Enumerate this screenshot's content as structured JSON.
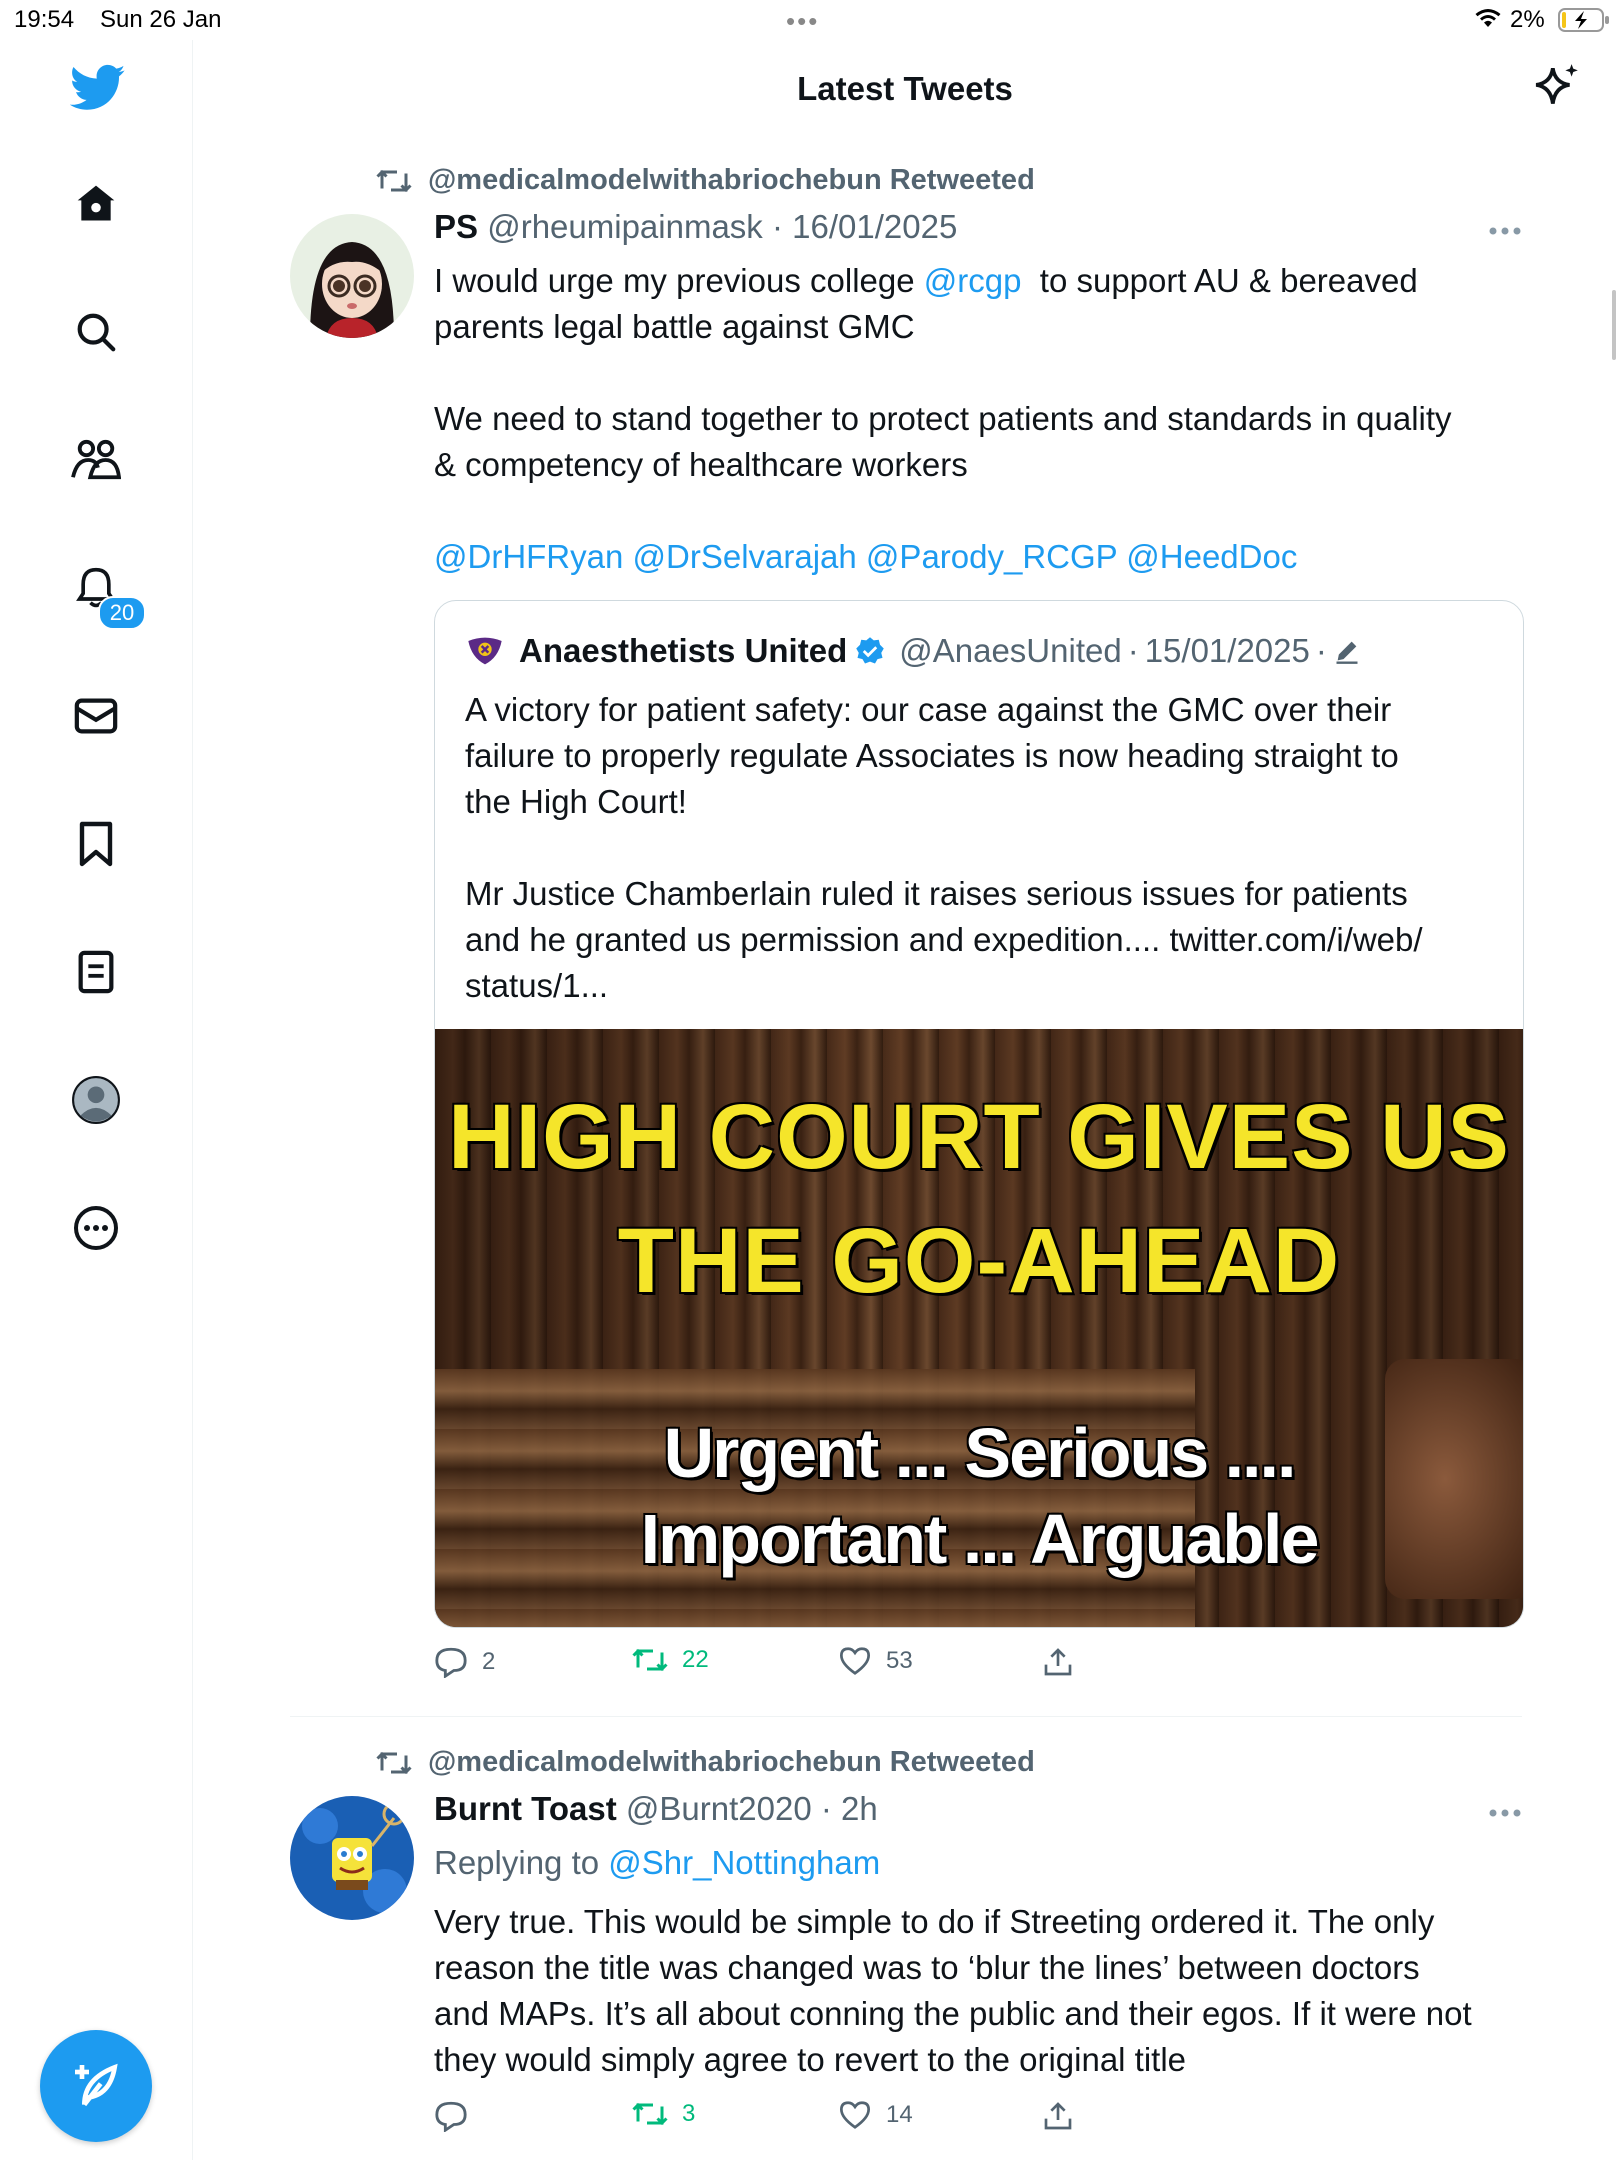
{
  "status_bar": {
    "time": "19:54",
    "date": "Sun 26 Jan",
    "dots": "•••",
    "battery": "2%"
  },
  "header": {
    "title": "Latest Tweets"
  },
  "sidebar": {
    "items": [
      {
        "icon": "home-icon"
      },
      {
        "icon": "search-icon"
      },
      {
        "icon": "communities-icon"
      },
      {
        "icon": "notifications-icon",
        "badge": "20"
      },
      {
        "icon": "messages-icon"
      },
      {
        "icon": "bookmark-icon"
      },
      {
        "icon": "lists-icon"
      },
      {
        "icon": "profile-icon"
      },
      {
        "icon": "more-icon"
      }
    ]
  },
  "tweets": [
    {
      "retweeted_by": "@medicalmodelwithabriochebun Retweeted",
      "name": "PS",
      "handle": "@rheumipainmask",
      "sep": "·",
      "date": "16/01/2025",
      "text_line1_pre": "I would urge my previous college ",
      "mention_rcgp": "@rcgp",
      "text_line1_post": "  to support AU & bereaved",
      "text_line2": "parents legal battle against GMC",
      "text_line3": "We need to stand together to protect patients and standards in quality",
      "text_line4": "& competency of healthcare workers",
      "mentions": "@DrHFRyan @DrSelvarajah @Parody_RCGP @HeedDoc",
      "quote": {
        "name": "Anaesthetists United",
        "handle": "@AnaesUnited",
        "date": "15/01/2025",
        "sep": "·",
        "lines": [
          "A victory for patient safety: our case against the GMC over their",
          "failure to properly regulate Associates is now heading straight to",
          "the High Court!",
          "",
          "Mr Justice Chamberlain ruled it raises serious issues for patients",
          "and he granted us permission and expedition.... twitter.com/i/web/",
          "status/1..."
        ],
        "image_headline_1": "HIGH COURT GIVES US",
        "image_headline_2": "THE GO-AHEAD",
        "image_sub_1": "Urgent ... Serious ....",
        "image_sub_2": "Important ... Arguable"
      },
      "replies": "2",
      "retweets": "22",
      "likes": "53"
    },
    {
      "retweeted_by": "@medicalmodelwithabriochebun Retweeted",
      "name": "Burnt Toast",
      "handle": "@Burnt2020",
      "sep": "·",
      "date": "2h",
      "replying_label": "Replying to ",
      "replying_to": "@Shr_Nottingham",
      "lines": [
        "Very true. This would be simple to do if Streeting ordered it. The only",
        "reason the title was changed was to ‘blur the lines’ between doctors",
        "and MAPs. It’s all about conning the public and their egos. If it were not",
        "they would simply agree to revert to the original title"
      ],
      "replies": "",
      "retweets": "3",
      "likes": "14"
    }
  ],
  "colors": {
    "accent": "#1d9bf0",
    "retweet": "#00ba7c",
    "muted": "#536471",
    "headline": "#f5e52a"
  }
}
